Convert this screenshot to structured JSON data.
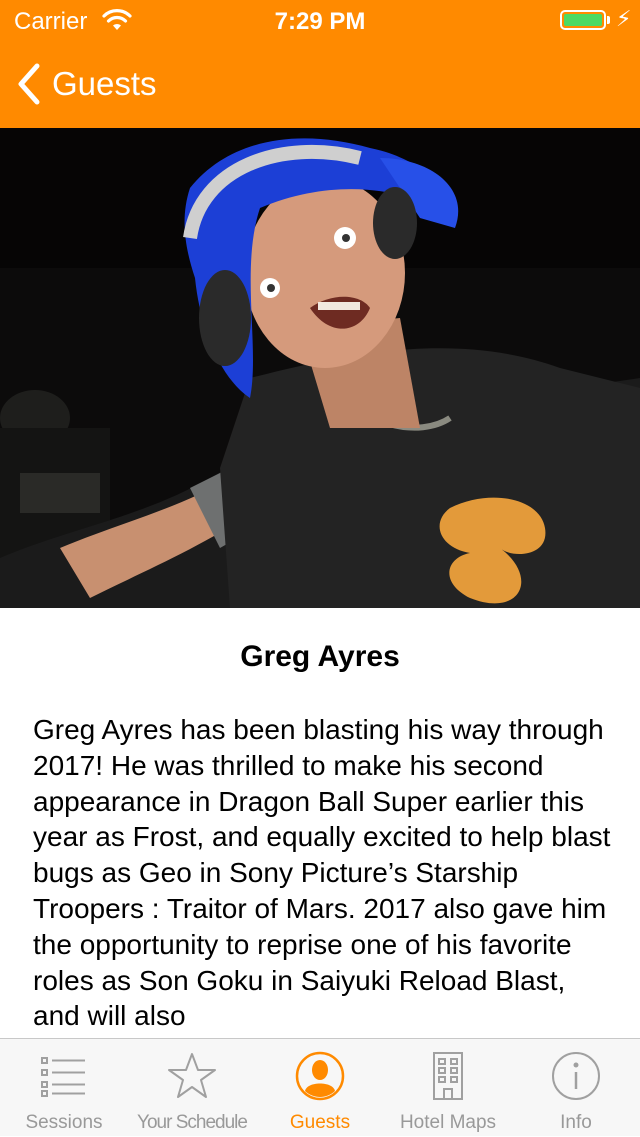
{
  "status": {
    "carrier": "Carrier",
    "time": "7:29 PM",
    "battery_color": "#4cd964"
  },
  "nav": {
    "back_label": "Guests",
    "bar_color": "#ff8a00"
  },
  "guest": {
    "name": "Greg Ayres",
    "photo_alt": "Greg Ayres DJing with blue hair and headphones",
    "bio": "Greg Ayres has been blasting his way through 2017!  He was thrilled to make his second appearance in Dragon Ball Super earlier this year as Frost, and equally excited to help blast bugs as Geo in Sony Picture’s Starship Troopers : Traitor of Mars. 2017 also gave him the opportunity to reprise one of his favorite roles as Son Goku in Saiyuki Reload Blast, and will also"
  },
  "tabs": [
    {
      "label": "Sessions",
      "icon": "list-icon",
      "active": false
    },
    {
      "label": "Your Schedule",
      "icon": "star-icon",
      "active": false
    },
    {
      "label": "Guests",
      "icon": "person-icon",
      "active": true
    },
    {
      "label": "Hotel Maps",
      "icon": "building-icon",
      "active": false
    },
    {
      "label": "Info",
      "icon": "info-icon",
      "active": false
    }
  ],
  "accent_color": "#ff8a00"
}
